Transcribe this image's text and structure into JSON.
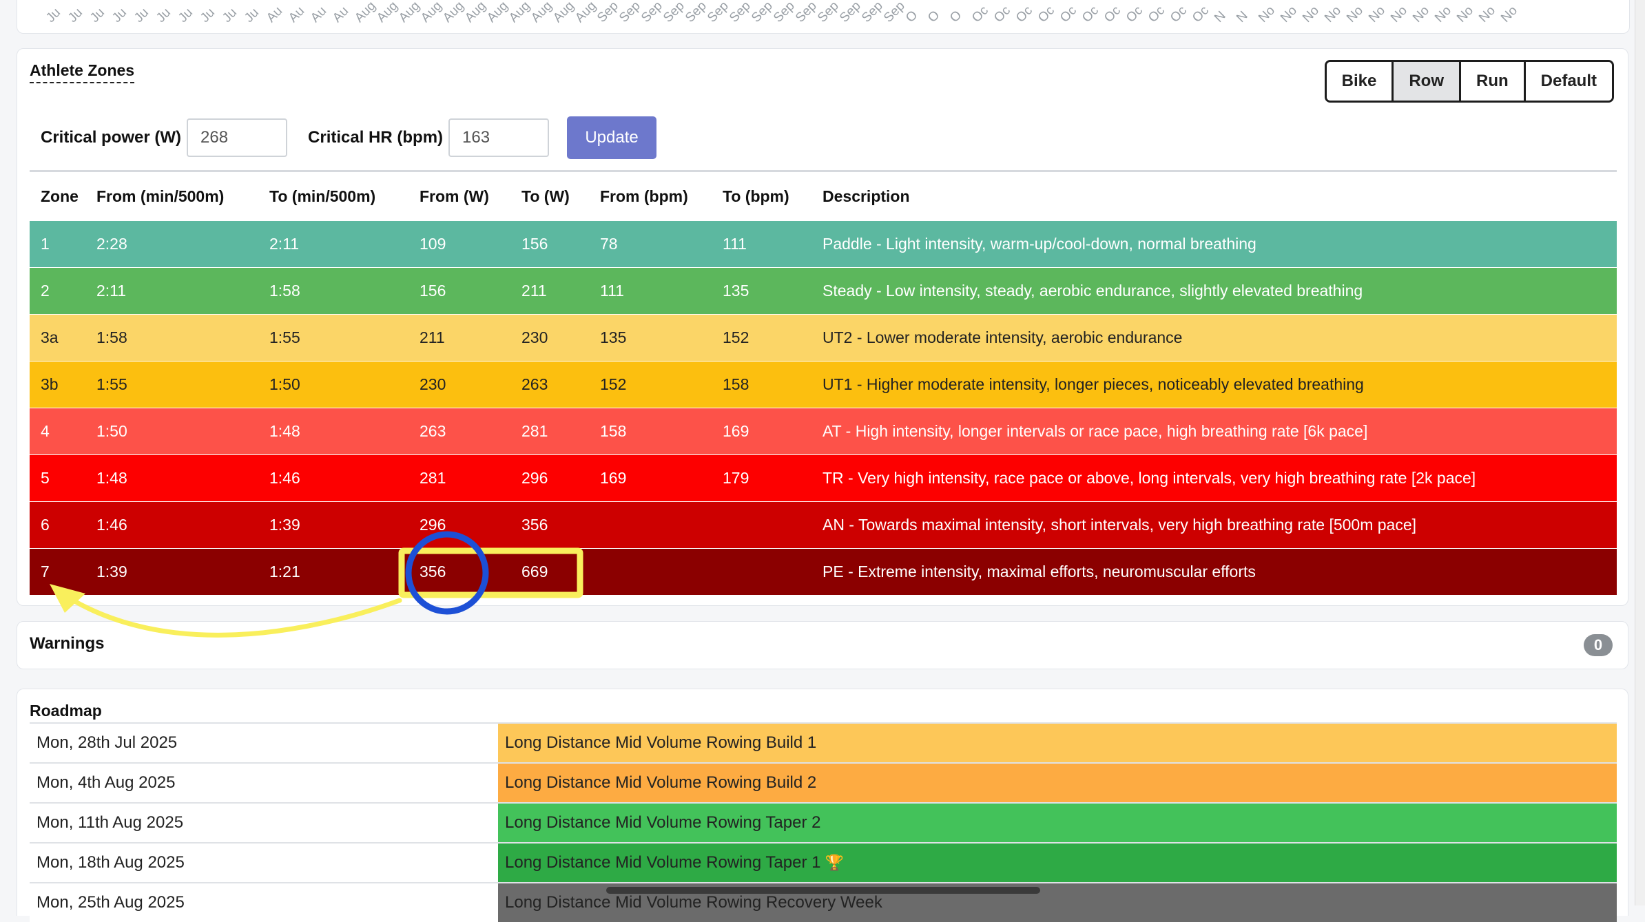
{
  "top_axis": {
    "ticks": [
      "Ju",
      "Ju",
      "Ju",
      "Ju",
      "Ju",
      "Ju",
      "Ju",
      "Ju",
      "Ju",
      "Ju",
      "Au",
      "Au",
      "Au",
      "Au",
      "Aug",
      "Aug",
      "Aug",
      "Aug",
      "Aug",
      "Aug",
      "Aug",
      "Aug",
      "Aug",
      "Aug",
      "Aug",
      "Sep",
      "Sep",
      "Sep",
      "Sep",
      "Sep",
      "Sep",
      "Sep",
      "Sep",
      "Sep",
      "Sep",
      "Sep",
      "Sep",
      "Sep",
      "Sep",
      "O",
      "O",
      "O",
      "Oc",
      "Oc",
      "Oc",
      "Oc",
      "Oc",
      "Oc",
      "Oc",
      "Oc",
      "Oc",
      "Oc",
      "Oc",
      "N",
      "N",
      "No",
      "No",
      "No",
      "No",
      "No",
      "No",
      "No",
      "No",
      "No",
      "No",
      "No",
      "No"
    ]
  },
  "zones": {
    "title": "Athlete Zones",
    "sports": [
      {
        "label": "Bike",
        "active": false
      },
      {
        "label": "Row",
        "active": true
      },
      {
        "label": "Run",
        "active": false
      },
      {
        "label": "Default",
        "active": false
      }
    ],
    "critical_power_label": "Critical power (W)",
    "critical_power_value": "268",
    "critical_hr_label": "Critical HR (bpm)",
    "critical_hr_value": "163",
    "update_label": "Update",
    "headers": [
      "Zone",
      "From (min/500m)",
      "To (min/500m)",
      "From (W)",
      "To (W)",
      "From (bpm)",
      "To (bpm)",
      "Description"
    ],
    "rows": [
      {
        "zone": "1",
        "from_pace": "2:28",
        "to_pace": "2:11",
        "from_w": "109",
        "to_w": "156",
        "from_bpm": "78",
        "to_bpm": "111",
        "description": "Paddle - Light intensity, warm-up/cool-down, normal breathing",
        "color": "#5cb8a0"
      },
      {
        "zone": "2",
        "from_pace": "2:11",
        "to_pace": "1:58",
        "from_w": "156",
        "to_w": "211",
        "from_bpm": "111",
        "to_bpm": "135",
        "description": "Steady - Low intensity, steady, aerobic endurance, slightly elevated breathing",
        "color": "#5cb75c"
      },
      {
        "zone": "3a",
        "from_pace": "1:58",
        "to_pace": "1:55",
        "from_w": "211",
        "to_w": "230",
        "from_bpm": "135",
        "to_bpm": "152",
        "description": "UT2 - Lower moderate intensity, aerobic endurance",
        "color": "#fbd567",
        "text": "#222222"
      },
      {
        "zone": "3b",
        "from_pace": "1:55",
        "to_pace": "1:50",
        "from_w": "230",
        "to_w": "263",
        "from_bpm": "152",
        "to_bpm": "158",
        "description": "UT1 - Higher moderate intensity, longer pieces, noticeably elevated breathing",
        "color": "#fcbf0f",
        "text": "#222222"
      },
      {
        "zone": "4",
        "from_pace": "1:50",
        "to_pace": "1:48",
        "from_w": "263",
        "to_w": "281",
        "from_bpm": "158",
        "to_bpm": "169",
        "description": "AT - High intensity, longer intervals or race pace, high breathing rate [6k pace]",
        "color": "#fd5249"
      },
      {
        "zone": "5",
        "from_pace": "1:48",
        "to_pace": "1:46",
        "from_w": "281",
        "to_w": "296",
        "from_bpm": "169",
        "to_bpm": "179",
        "description": "TR - Very high intensity, race pace or above, long intervals, very high breathing rate [2k pace]",
        "color": "#fd0000"
      },
      {
        "zone": "6",
        "from_pace": "1:46",
        "to_pace": "1:39",
        "from_w": "296",
        "to_w": "356",
        "from_bpm": "",
        "to_bpm": "",
        "description": "AN - Towards maximal intensity, short intervals, very high breathing rate [500m pace]",
        "color": "#cd0000"
      },
      {
        "zone": "7",
        "from_pace": "1:39",
        "to_pace": "1:21",
        "from_w": "356",
        "to_w": "669",
        "from_bpm": "",
        "to_bpm": "",
        "description": "PE - Extreme intensity, maximal efforts, neuromuscular efforts",
        "color": "#8b0000"
      }
    ]
  },
  "warnings": {
    "title": "Warnings",
    "count": "0"
  },
  "roadmap": {
    "title": "Roadmap",
    "rows": [
      {
        "date": "Mon, 28th Jul 2025",
        "plan": "Long Distance Mid Volume Rowing Build 1",
        "color": "#fdc758",
        "trophy": false
      },
      {
        "date": "Mon, 4th Aug 2025",
        "plan": "Long Distance Mid Volume Rowing Build 2",
        "color": "#fdab42",
        "trophy": false
      },
      {
        "date": "Mon, 11th Aug 2025",
        "plan": "Long Distance Mid Volume Rowing Taper 2",
        "color": "#43c25a",
        "trophy": false
      },
      {
        "date": "Mon, 18th Aug 2025",
        "plan": "Long Distance Mid Volume Rowing Taper 1",
        "color": "#2eaa45",
        "trophy": true,
        "trophy_icon": "🏆"
      },
      {
        "date": "Mon, 25th Aug 2025",
        "plan": "Long Distance Mid Volume Rowing Recovery Week",
        "color": "#6b6b6b",
        "trophy": false
      }
    ]
  }
}
